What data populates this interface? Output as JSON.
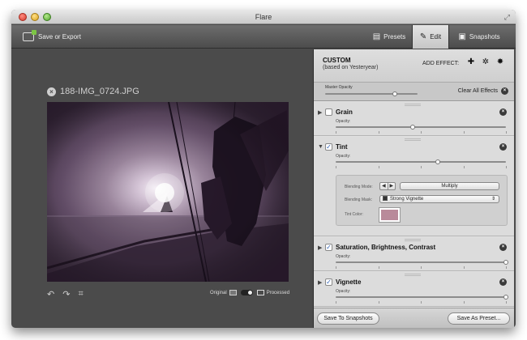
{
  "window": {
    "title": "Flare"
  },
  "toolbar": {
    "save_export_label": "Save or Export",
    "tabs": [
      {
        "label": "Presets",
        "icon": "presets-icon",
        "active": false
      },
      {
        "label": "Edit",
        "icon": "edit-icon",
        "active": true
      },
      {
        "label": "Snapshots",
        "icon": "snapshots-icon",
        "active": false
      }
    ]
  },
  "photo": {
    "filename": "188-IMG_0724.JPG"
  },
  "compare": {
    "original_label": "Original",
    "processed_label": "Processed"
  },
  "panel": {
    "preset_name": "CUSTOM",
    "preset_based_on": "(based on Yesteryear)",
    "add_effect_label": "ADD EFFECT:",
    "add_effect_icons": [
      "add-effect-plus-icon",
      "add-effect-gear-icon",
      "add-effect-star-icon"
    ],
    "master_opacity_label": "Master Opacity",
    "master_opacity_value": 0.75,
    "clear_all_label": "Clear All Effects",
    "effects": [
      {
        "name": "Grain",
        "enabled": false,
        "expanded": false,
        "opacity_label": "Opacity:",
        "opacity_value": 0.45
      },
      {
        "name": "Tint",
        "enabled": true,
        "expanded": true,
        "opacity_label": "Opacity:",
        "opacity_value": 0.6
      },
      {
        "name": "Saturation, Brightness, Contrast",
        "enabled": true,
        "expanded": false,
        "opacity_label": "Opacity:",
        "opacity_value": 1.0
      },
      {
        "name": "Vignette",
        "enabled": true,
        "expanded": false,
        "opacity_label": "Opacity:",
        "opacity_value": 1.0
      }
    ],
    "tint": {
      "blending_mode_label": "Blending Mode:",
      "blending_mode_value": "Multiply",
      "blending_mask_label": "Blending Mask:",
      "blending_mask_value": "Strong Vignette",
      "tint_color_label": "Tint Color:",
      "tint_color": "#b98a9a"
    },
    "footer": {
      "save_to_snapshots_label": "Save To Snapshots",
      "save_as_preset_label": "Save As Preset..."
    }
  },
  "colors": {
    "window_bg": "#4b4b4b",
    "panel_bg": "#e1e1e1",
    "check_blue": "#2a5db3"
  }
}
